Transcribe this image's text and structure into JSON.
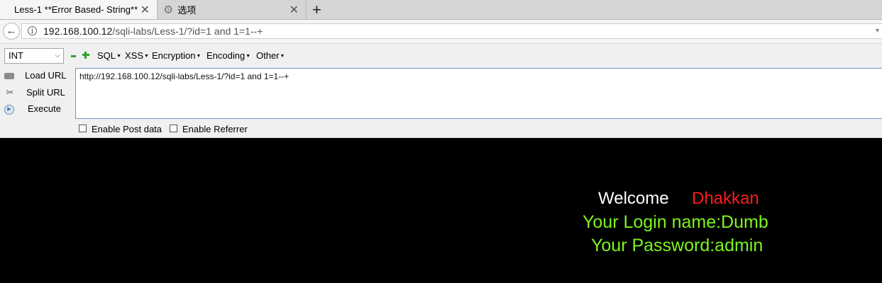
{
  "tabs": [
    {
      "title": "Less-1 **Error Based- String**",
      "active": true,
      "close": "✕"
    },
    {
      "title": "选项",
      "active": false,
      "close": "✕",
      "icon": "gear-icon"
    }
  ],
  "newtab_label": "+",
  "navbar": {
    "back_icon": "←",
    "info_icon": "i",
    "url_host": "192.168.100.12",
    "url_path": "/sqli-labs/Less-1/?id=1 and 1=1--+"
  },
  "hackbar": {
    "select_value": "INT",
    "menus": [
      "SQL",
      "XSS",
      "Encryption",
      "Encoding",
      "Other"
    ],
    "actions": [
      "Load URL",
      "Split URL",
      "Execute"
    ],
    "textarea_value": "http://192.168.100.12/sqli-labs/Less-1/?id=1 and 1=1--+",
    "checkboxes": [
      "Enable Post data",
      "Enable Referrer"
    ]
  },
  "page": {
    "welcome": "Welcome",
    "username": "Dhakkan",
    "login_name": "Your Login name:Dumb",
    "password": "Your Password:admin"
  },
  "colors": {
    "welcome": "#ffffff",
    "username": "#ff1a1a",
    "result": "#7cf51e",
    "background": "#000000"
  }
}
